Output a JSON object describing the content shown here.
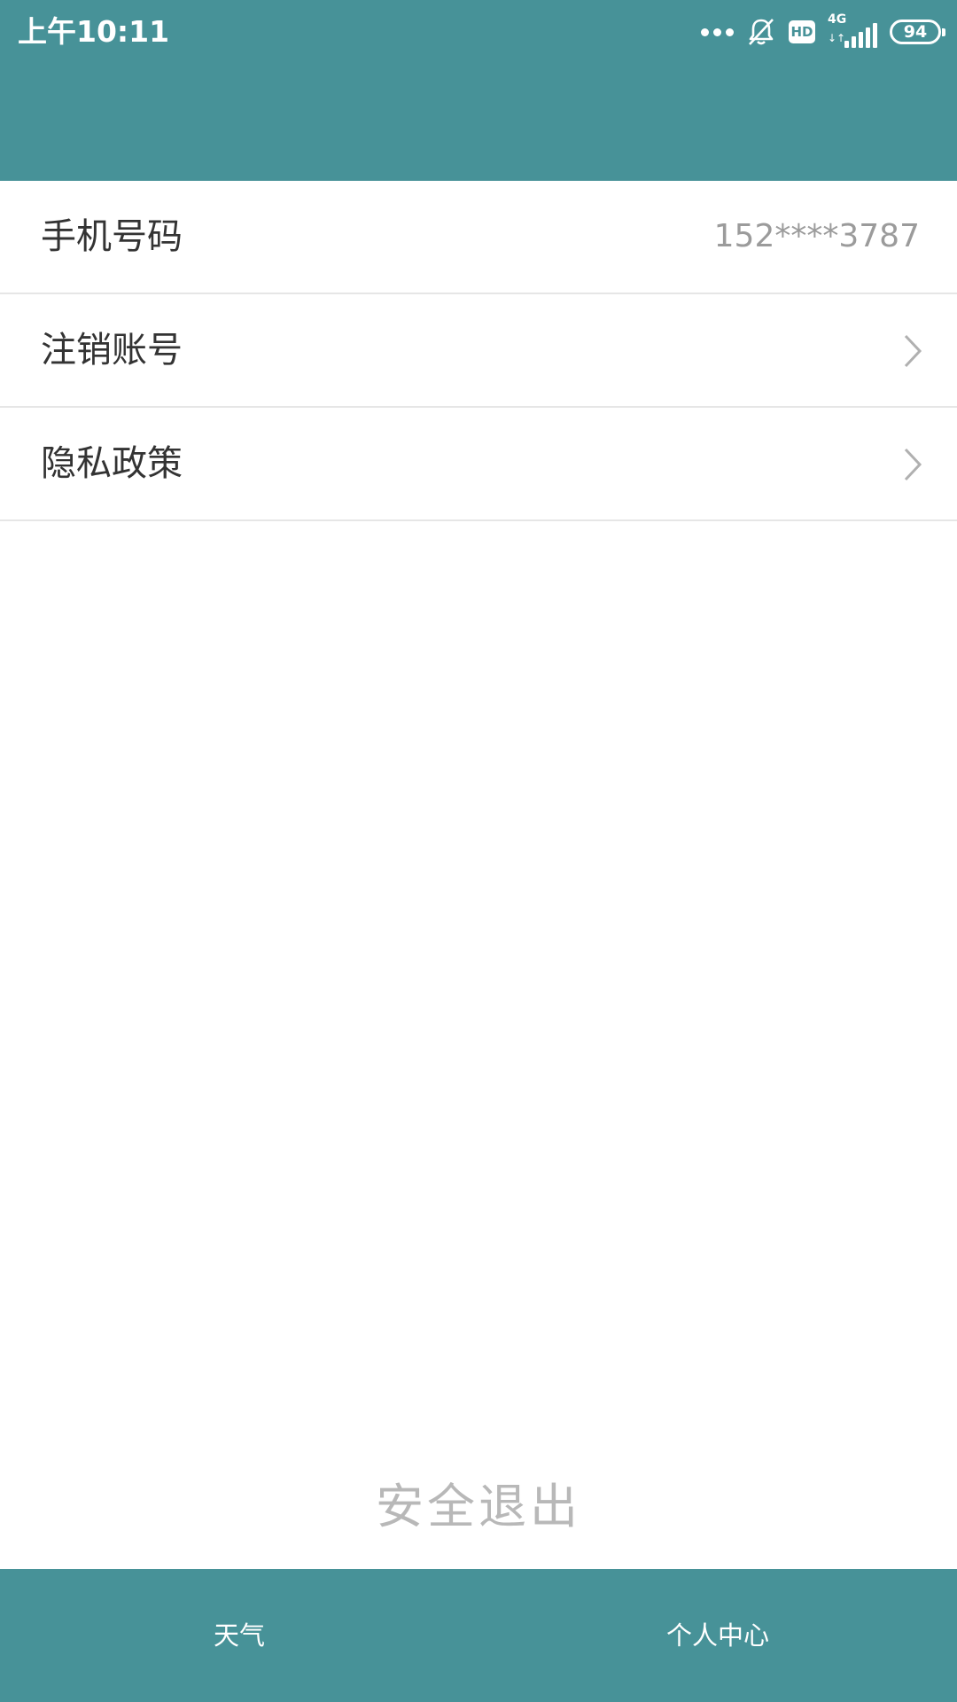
{
  "status_bar": {
    "time": "上午10:11",
    "network": "4G",
    "network_arrows": "↓↑",
    "hd_badge": "HD",
    "battery": "94",
    "icons": [
      "more-dots-icon",
      "bell-off-icon",
      "hd-icon",
      "signal-icon",
      "battery-icon"
    ]
  },
  "colors": {
    "header_bg": "#479298",
    "nav_bg": "#479298",
    "row_label": "#333333",
    "row_value": "#9b9b9b",
    "logout_text": "#b8b8b8"
  },
  "list": {
    "items": [
      {
        "label": "手机号码",
        "value": "152****3787"
      },
      {
        "label": "注销账号",
        "icon": "chevron-right-icon"
      },
      {
        "label": "隐私政策",
        "icon": "chevron-right-icon"
      }
    ]
  },
  "logout": {
    "label": "安全退出"
  },
  "bottom_nav": {
    "items": [
      {
        "label": "天气"
      },
      {
        "label": "个人中心"
      }
    ]
  }
}
